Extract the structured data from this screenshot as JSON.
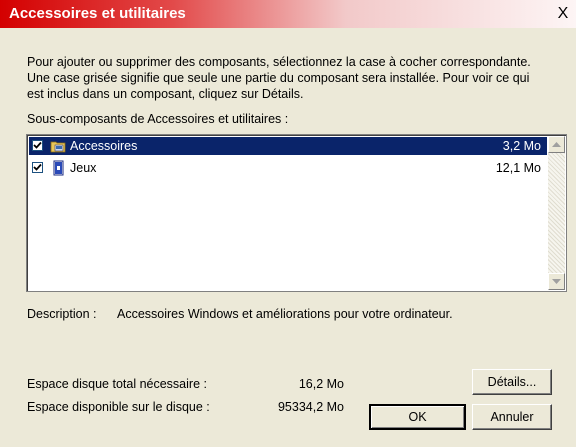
{
  "window": {
    "title": "Accessoires et utilitaires",
    "close_label": "X"
  },
  "intro": "Pour ajouter ou supprimer des composants, sélectionnez la case à cocher correspondante. Une case grisée signifie que seule une partie du composant sera installée. Pour voir ce qui est inclus dans un composant, cliquez sur Détails.",
  "list": {
    "label": "Sous-composants de Accessoires et utilitaires :",
    "items": [
      {
        "label": "Accessoires",
        "size": "3,2 Mo",
        "checked": true,
        "selected": true,
        "icon": "accessories-folder-icon"
      },
      {
        "label": "Jeux",
        "size": "12,1 Mo",
        "checked": true,
        "selected": false,
        "icon": "games-icon"
      }
    ]
  },
  "description": {
    "label": "Description :",
    "text": "Accessoires Windows et améliorations pour votre ordinateur."
  },
  "space": {
    "required_label": "Espace disque total nécessaire :",
    "required_value": "16,2 Mo",
    "available_label": "Espace disponible sur le disque :",
    "available_value": "95334,2 Mo"
  },
  "buttons": {
    "details": "Détails...",
    "ok": "OK",
    "cancel": "Annuler"
  },
  "colors": {
    "title_red": "#d40000",
    "selection": "#0a246a",
    "dialog_bg": "#ece9d8"
  }
}
